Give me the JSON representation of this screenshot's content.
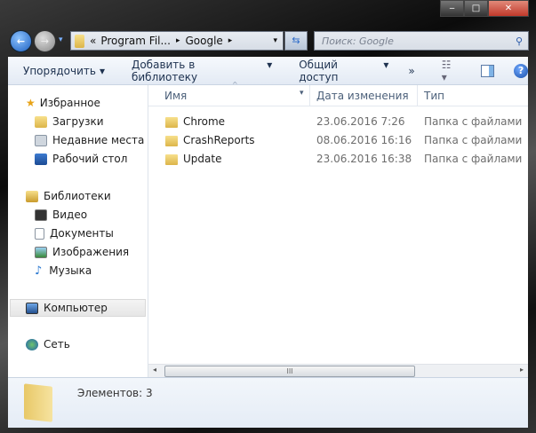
{
  "window": {
    "minimize": "‒",
    "maximize": "□",
    "close": "✕"
  },
  "address": {
    "overflow": "«",
    "crumbs": [
      "Program Fil...",
      "Google"
    ],
    "sep": "▸"
  },
  "search": {
    "placeholder": "Поиск: Google"
  },
  "toolbar": {
    "organize": "Упорядочить",
    "add_library": "Добавить в библиотеку",
    "share": "Общий доступ",
    "more": "»",
    "arrow": "▾"
  },
  "nav": {
    "favorites": "Избранное",
    "downloads": "Загрузки",
    "recent": "Недавние места",
    "desktop": "Рабочий стол",
    "libraries": "Библиотеки",
    "video": "Видео",
    "documents": "Документы",
    "pictures": "Изображения",
    "music": "Музыка",
    "computer": "Компьютер",
    "network": "Сеть"
  },
  "columns": {
    "name": "Имя",
    "date": "Дата изменения",
    "type": "Тип"
  },
  "files": [
    {
      "name": "Chrome",
      "date": "23.06.2016 7:26",
      "type": "Папка с файлами"
    },
    {
      "name": "CrashReports",
      "date": "08.06.2016 16:16",
      "type": "Папка с файлами"
    },
    {
      "name": "Update",
      "date": "23.06.2016 16:38",
      "type": "Папка с файлами"
    }
  ],
  "status": {
    "count": "Элементов: 3"
  }
}
